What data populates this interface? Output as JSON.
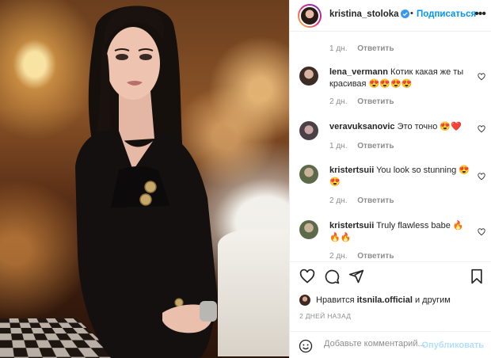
{
  "post": {
    "author": "kristina_stoloka",
    "follow_label": "Подписаться",
    "separator": "•",
    "more_label": "•••"
  },
  "comments": [
    {
      "partial": true,
      "time": "1 дн.",
      "reply": "Ответить"
    },
    {
      "user": "lena_vermann",
      "text": "Котик какая же ты красивая",
      "emoji": "😍😍😍😍",
      "time": "2 дн.",
      "reply": "Ответить"
    },
    {
      "user": "veravuksanovic",
      "text": "Это точно",
      "emoji": "😍❤️",
      "time": "1 дн.",
      "reply": "Ответить"
    },
    {
      "user": "kristertsuii",
      "text": "You look so stunning",
      "emoji": "😍😍",
      "time": "2 дн.",
      "reply": "Ответить"
    },
    {
      "user": "kristertsuii",
      "text": "Truly flawless babe",
      "emoji": "🔥🔥🔥",
      "time": "2 дн.",
      "reply": "Ответить"
    }
  ],
  "likes": {
    "prefix": "Нравится",
    "user": "itsnila.official",
    "suffix": "и другим"
  },
  "date": "2 ДНЕЙ НАЗАД",
  "add_comment": {
    "placeholder": "Добавьте комментарий...",
    "publish_label": "Опубликовать"
  },
  "colors": {
    "accent": "#0095f6",
    "publish_disabled": "#b2dffc",
    "heart_red": "#ed4956",
    "muted": "#8e8e8e"
  },
  "icons": [
    "verified-badge-icon",
    "heart-icon",
    "comment-icon",
    "share-icon",
    "bookmark-icon",
    "smile-icon",
    "more-icon"
  ]
}
